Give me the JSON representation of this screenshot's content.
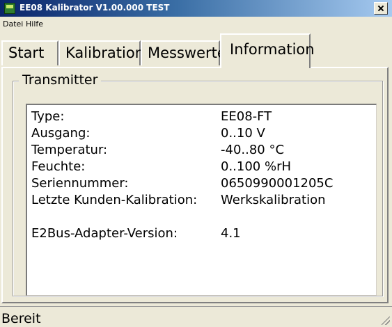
{
  "window": {
    "title": "EE08 Kalibrator V1.00.000 TEST"
  },
  "menu": [
    "Datei",
    "Hilfe"
  ],
  "tabs": [
    "Start",
    "Kalibration",
    "Messwerte",
    "Information"
  ],
  "active_tab": "Information",
  "group": {
    "title": "Transmitter"
  },
  "info": [
    {
      "label": "Type:",
      "value": "EE08-FT"
    },
    {
      "label": "Ausgang:",
      "value": "0..10 V"
    },
    {
      "label": "Temperatur:",
      "value": "-40..80 °C"
    },
    {
      "label": "Feuchte:",
      "value": "0..100 %rH"
    },
    {
      "label": "Seriennummer:",
      "value": "0650990001205C"
    },
    {
      "label": "Letzte Kunden-Kalibration:",
      "value": "Werkskalibration"
    },
    {
      "label": "E2Bus-Adapter-Version:",
      "value": "4.1"
    }
  ],
  "status": {
    "text": "Bereit"
  }
}
